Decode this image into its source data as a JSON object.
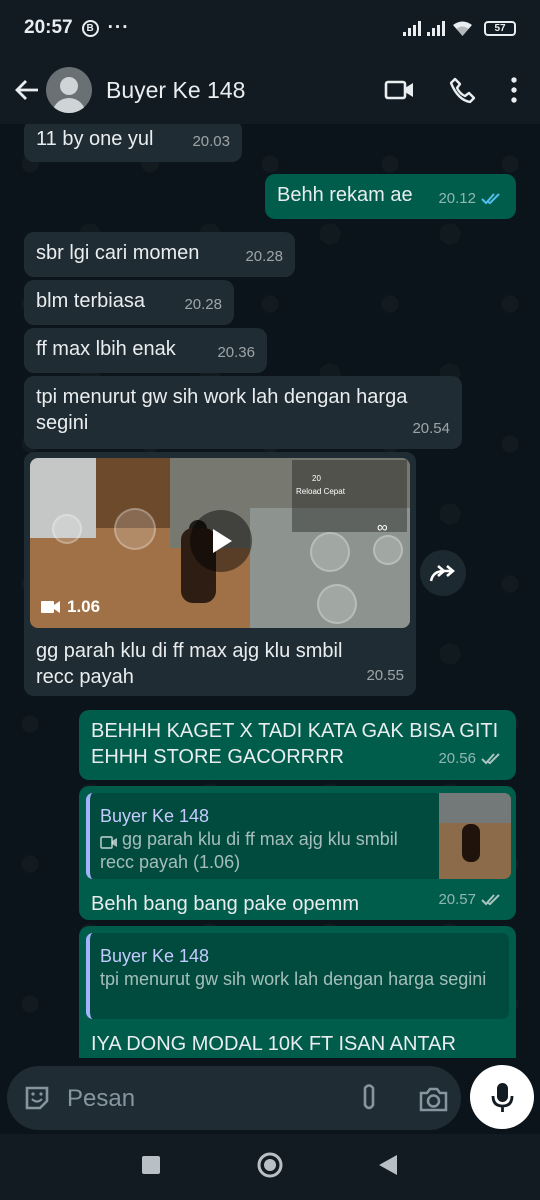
{
  "status_bar": {
    "time": "20:57",
    "b_badge": "B",
    "more": "···",
    "battery": "57"
  },
  "header": {
    "contact_name": "Buyer Ke 148",
    "icons": [
      "back-arrow-icon",
      "video-call-icon",
      "phone-icon",
      "more-vertical-icon"
    ]
  },
  "messages": [
    {
      "type": "in",
      "text": "11 by one yul",
      "time": "20.03"
    },
    {
      "type": "out",
      "text": "Behh rekam ae",
      "time": "20.12",
      "status": "read"
    },
    {
      "type": "in",
      "text": "sbr lgi cari momen",
      "time": "20.28"
    },
    {
      "type": "in",
      "text": "blm terbiasa",
      "time": "20.28"
    },
    {
      "type": "in",
      "text": "ff max lbih enak",
      "time": "20.36"
    },
    {
      "type": "in",
      "text": "tpi menurut gw sih work lah dengan harga segini",
      "time": "20.54"
    },
    {
      "type": "in-video",
      "duration": "1.06",
      "caption": "gg parah klu di ff max ajg klu smbil recc payah",
      "time": "20.55"
    },
    {
      "type": "out",
      "text": "BEHHH KAGET X TADI KATA GAK BISA GITI EHHH STORE GACORRRR",
      "time": "20.56",
      "status": "delivered"
    },
    {
      "type": "out-reply",
      "reply_name": "Buyer Ke 148",
      "reply_text": "gg parah klu di ff max ajg klu smbil recc payah (1.06)",
      "text": "Behh bang bang pake opemm",
      "time": "20.57",
      "status": "delivered"
    },
    {
      "type": "out-reply",
      "reply_name": "Buyer Ke 148",
      "reply_text": "tpi menurut gw sih work lah dengan harga segini",
      "text": "IYA DONG MODAL 10K FT ISAN ANTAR"
    }
  ],
  "video_overlay": {
    "counter": "20",
    "reload": "Reload Cepat",
    "infinity": "∞"
  },
  "composer": {
    "placeholder": "Pesan"
  },
  "colors": {
    "background": "#0b141a",
    "incoming": "#202c33",
    "outgoing": "#005c4b",
    "read_ticks": "#53bdeb",
    "reply_accent": "#a5b3ff"
  }
}
